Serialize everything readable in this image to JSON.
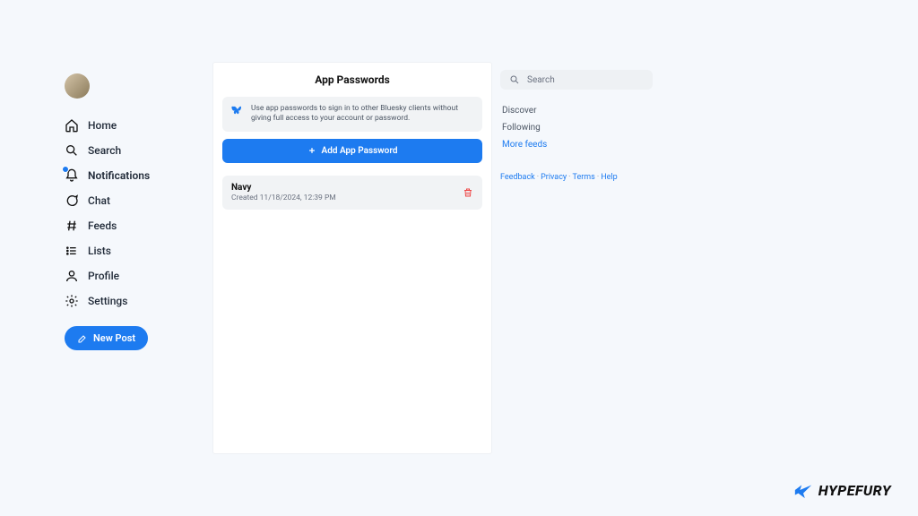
{
  "sidebar": {
    "items": [
      {
        "label": "Home"
      },
      {
        "label": "Search"
      },
      {
        "label": "Notifications"
      },
      {
        "label": "Chat"
      },
      {
        "label": "Feeds"
      },
      {
        "label": "Lists"
      },
      {
        "label": "Profile"
      },
      {
        "label": "Settings"
      }
    ],
    "new_post_label": "New Post"
  },
  "main": {
    "title": "App Passwords",
    "info_text": "Use app passwords to sign in to other Bluesky clients without giving full access to your account or password.",
    "add_button_label": "Add App Password",
    "passwords": [
      {
        "name": "Navy",
        "created_line": "Created 11/18/2024, 12:39 PM"
      }
    ]
  },
  "right": {
    "search_placeholder": "Search",
    "feeds": [
      {
        "label": "Discover"
      },
      {
        "label": "Following"
      }
    ],
    "more_feeds_label": "More feeds",
    "footer": {
      "feedback": "Feedback",
      "privacy": "Privacy",
      "terms": "Terms",
      "help": "Help"
    }
  },
  "brand": "HYPEFURY"
}
